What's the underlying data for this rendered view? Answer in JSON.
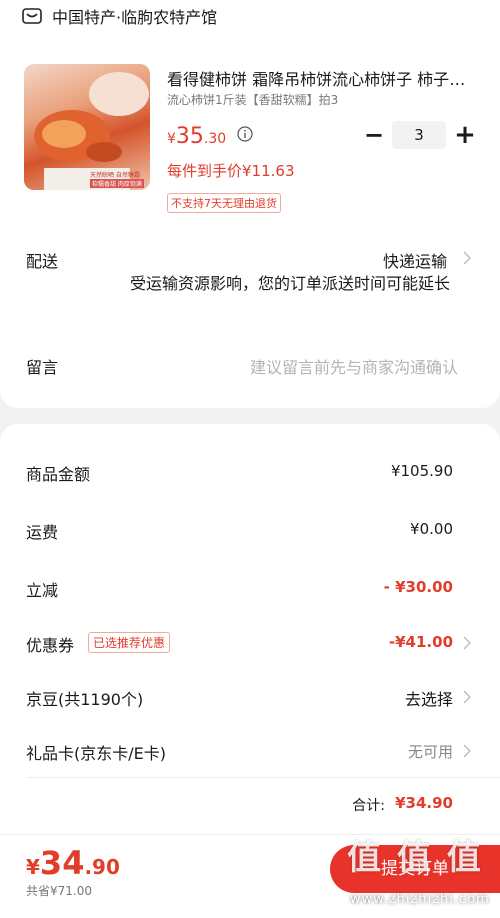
{
  "shop": {
    "name": "中国特产·临朐农特产馆",
    "icon": "shop-icon"
  },
  "product": {
    "title": "看得健柿饼 霜降吊柿饼流心柿饼子 柿子干农家特产",
    "spec": "流心柿饼1斤装【香甜软糯】拍3",
    "price": {
      "currency": "¥",
      "integer": "35",
      "decimal": ".30"
    },
    "unit_price": "每件到手价¥11.63",
    "no_return_tag": "不支持7天无理由退货",
    "quantity": "3",
    "image_text": [
      "天然晾晒 自然糖霜",
      "软糯香甜 肉厚饱满"
    ]
  },
  "stepper": {
    "minus": "−",
    "plus": "+"
  },
  "delivery": {
    "label": "配送",
    "method": "快递运输",
    "note": "受运输资源影响，您的订单派送时间可能延长"
  },
  "remark": {
    "label": "留言",
    "placeholder": "建议留言前先与商家沟通确认"
  },
  "summary": {
    "goods_amount": {
      "label": "商品金额",
      "value": "¥105.90"
    },
    "shipping": {
      "label": "运费",
      "value": "¥0.00"
    },
    "discount": {
      "label": "立减",
      "value": "- ¥30.00"
    },
    "coupon": {
      "label": "优惠券",
      "badge": "已选推荐优惠",
      "value": "-¥41.00"
    },
    "jingdou": {
      "label": "京豆(共1190个)",
      "value": "去选择"
    },
    "giftcard": {
      "label": "礼品卡(京东卡/E卡)",
      "value": "无可用"
    },
    "total": {
      "label": "合计:",
      "value": "¥34.90"
    }
  },
  "bottom": {
    "price": {
      "currency": "¥",
      "integer": "34",
      "decimal": ".90"
    },
    "saved": "共省¥71.00",
    "submit_label": "提交订单"
  },
  "watermark": {
    "logo": "值 值 值",
    "url": "www.zhizhizhi.com"
  },
  "colors": {
    "accent": "#e23c2a",
    "button": "#e8332a",
    "muted": "#888888"
  }
}
